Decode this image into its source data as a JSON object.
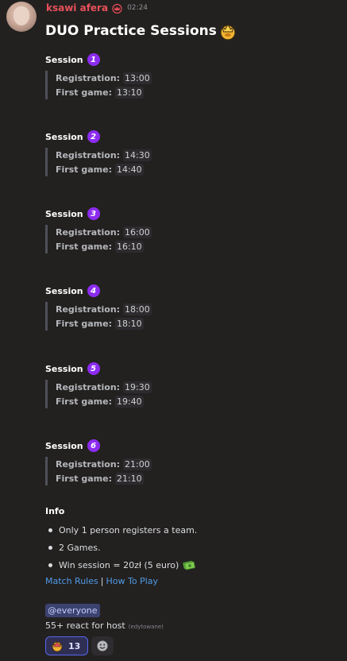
{
  "message": {
    "username": "ksawi afera",
    "timestamp": "02:24",
    "title": "DUO Practice Sessions",
    "title_emoji": "crown-emoji"
  },
  "sessions": [
    {
      "label": "Session",
      "number": "1",
      "registration_label": "Registration:",
      "registration_time": "13:00",
      "first_game_label": "First game:",
      "first_game_time": "13:10"
    },
    {
      "label": "Session",
      "number": "2",
      "registration_label": "Registration:",
      "registration_time": "14:30",
      "first_game_label": "First game:",
      "first_game_time": "14:40"
    },
    {
      "label": "Session",
      "number": "3",
      "registration_label": "Registration:",
      "registration_time": "16:00",
      "first_game_label": "First game:",
      "first_game_time": "16:10"
    },
    {
      "label": "Session",
      "number": "4",
      "registration_label": "Registration:",
      "registration_time": "18:00",
      "first_game_label": "First game:",
      "first_game_time": "18:10"
    },
    {
      "label": "Session",
      "number": "5",
      "registration_label": "Registration:",
      "registration_time": "19:30",
      "first_game_label": "First game:",
      "first_game_time": "19:40"
    },
    {
      "label": "Session",
      "number": "6",
      "registration_label": "Registration:",
      "registration_time": "21:00",
      "first_game_label": "First game:",
      "first_game_time": "21:10"
    }
  ],
  "info": {
    "title": "Info",
    "items": [
      "Only 1 person registers a team.",
      "2 Games.",
      "Win session = 20zł (5 euro)"
    ]
  },
  "links": {
    "match_rules": "Match Rules",
    "separator": "|",
    "how_to_play": "How To Play"
  },
  "mention": "@everyone",
  "react_text": "55+ react for host",
  "edited_label": "(edytowane)",
  "reactions": [
    {
      "icon": "crown-emoji",
      "count": "13"
    }
  ],
  "colors": {
    "background": "#232120",
    "username": "#e8505a",
    "link": "#4f9ae6",
    "number_badge": "#8c2cf0",
    "mention_bg": "#3c4270"
  }
}
